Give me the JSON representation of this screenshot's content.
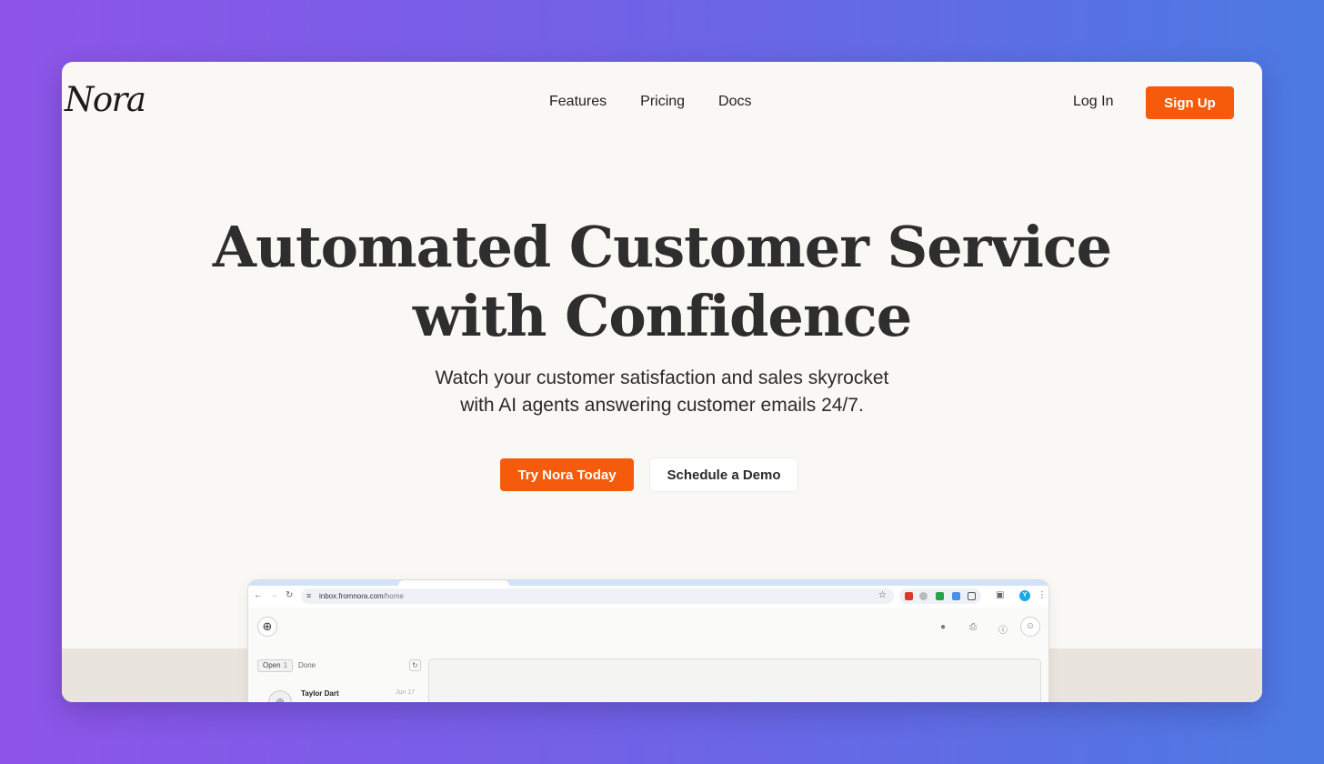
{
  "nav": {
    "logo": "Nora",
    "links": [
      "Features",
      "Pricing",
      "Docs"
    ],
    "login": "Log In",
    "signup": "Sign Up"
  },
  "hero": {
    "title_line1": "Automated Customer Service",
    "title_line2": "with Confidence",
    "subtitle_line1": "Watch your customer satisfaction and sales skyrocket",
    "subtitle_line2": "with AI agents answering customer emails 24/7.",
    "cta_primary": "Try Nora Today",
    "cta_secondary": "Schedule a Demo"
  },
  "browser": {
    "url_domain": "inbox.fromnora.com",
    "url_path": "/home",
    "profile_letter": "Y"
  },
  "app": {
    "filter_open": "Open",
    "filter_open_count": "1",
    "filter_done": "Done",
    "list": [
      {
        "name": "Taylor Dart",
        "date": "Jun 17"
      }
    ]
  },
  "colors": {
    "accent": "#f55b0a",
    "background_gradient_start": "#8e55e8",
    "background_gradient_end": "#4c7ae2",
    "page_bg": "#f9f8f5"
  }
}
